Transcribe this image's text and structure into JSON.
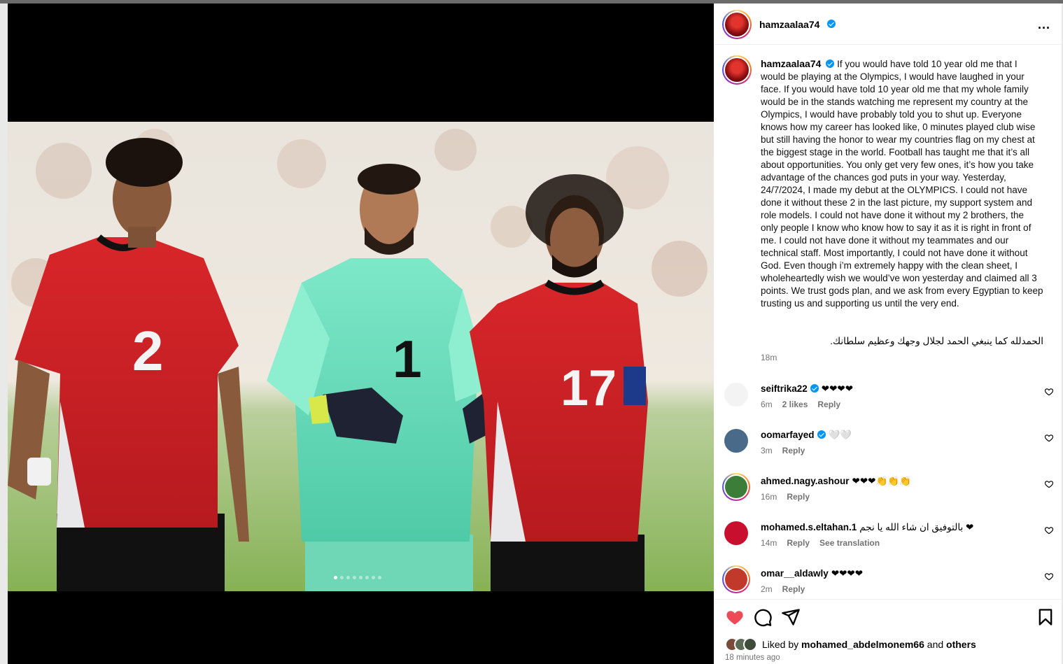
{
  "post": {
    "username": "hamzaalaa74",
    "caption": "If you would have told 10 year old me that I would be playing at the Olympics, I would have laughed in your face. If you would have told 10 year old me that my whole family would be in the stands watching me represent my country at the Olympics, I would have probably told you to shut up. Everyone knows how my career has looked like, 0 minutes played club wise but still having the honor to wear my countries flag on my chest at the biggest stage in the world. Football has taught me that it’s all about opportunities. You only get very few ones, it’s how you take advantage of the chances god puts in your way. Yesterday, 24/7/2024, I made my debut at the OLYMPICS. I could not have done it without these 2 in the last picture, my support system and role models. I could not have done it without my 2 brothers, the only people I know who know how to say it as it is right in front of me. I could not have done it without my teammates and our technical staff. Most importantly, I could not have done it without God. Even though i’m extremely happy with the clean sheet, I wholeheartedly wish we would’ve won yesterday and claimed all 3 points. We trust gods plan, and we ask from every Egyptian to keep trusting us and supporting us until the very end.",
    "caption_arabic": "الحمدلله كما ينبغي الحمد لجلال وجهك وعظيم سلطانك.",
    "caption_time": "18m",
    "more_icon": "...",
    "carousel_count": 8,
    "carousel_active": 0
  },
  "players": [
    {
      "number": "2",
      "kit": "red"
    },
    {
      "number": "1",
      "kit": "green"
    },
    {
      "number": "17",
      "kit": "red"
    }
  ],
  "comments": [
    {
      "username": "seiftrika22",
      "verified": true,
      "text": "❤❤❤❤",
      "time": "6m",
      "likes": "2 likes",
      "reply": "Reply",
      "translate": "",
      "avatar": "#f3f3f3",
      "ring": false
    },
    {
      "username": "oomarfayed",
      "verified": true,
      "text": "🤍🤍",
      "time": "3m",
      "likes": "",
      "reply": "Reply",
      "translate": "",
      "avatar": "#4a6a8a",
      "ring": false
    },
    {
      "username": "ahmed.nagy.ashour",
      "verified": false,
      "text": "❤❤❤👏👏👏",
      "time": "16m",
      "likes": "",
      "reply": "Reply",
      "translate": "",
      "avatar": "#3d7d3a",
      "ring": true
    },
    {
      "username": "mohamed.s.eltahan.1",
      "verified": false,
      "text": "بالتوفيق ان شاء الله يا نجم ❤",
      "time": "14m",
      "likes": "",
      "reply": "Reply",
      "translate": "See translation",
      "avatar": "#c8102e",
      "ring": false
    },
    {
      "username": "omar__aldawly",
      "verified": false,
      "text": "❤❤❤❤",
      "time": "2m",
      "likes": "",
      "reply": "Reply",
      "translate": "",
      "avatar": "#c0392b",
      "ring": true
    }
  ],
  "likes_line": {
    "prefix": "Liked by",
    "user": "mohamed_abdelmonem66",
    "and": "and",
    "others": "others"
  },
  "time_ago": "18 minutes ago",
  "colors": {
    "heart": "#ed4956",
    "verified": "#0095f6",
    "muted": "#737373"
  }
}
